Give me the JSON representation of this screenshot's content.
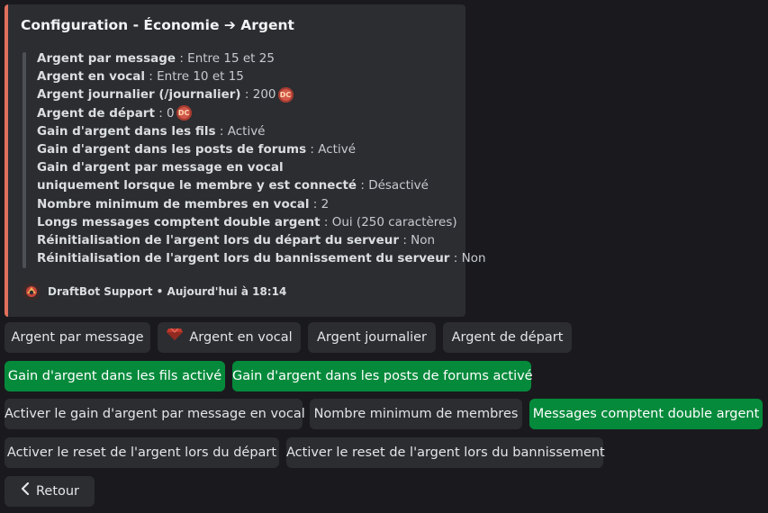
{
  "embed": {
    "title": "Configuration - Économie ➔ Argent",
    "lines": [
      {
        "key": "Argent par message",
        "value": " : Entre 15 et 25"
      },
      {
        "key": "Argent en vocal",
        "value": " : Entre 10 et 15"
      },
      {
        "key": "Argent journalier (/journalier)",
        "value": " : 200",
        "coin": "DC"
      },
      {
        "key": "Argent de départ",
        "value": " : 0",
        "coin": "DC"
      },
      {
        "key": "Gain d'argent dans les fils",
        "value": " : Activé"
      },
      {
        "key": "Gain d'argent dans les posts de forums",
        "value": " : Activé"
      },
      {
        "key": "Gain d'argent par message en vocal",
        "value": ""
      },
      {
        "key": "uniquement lorsque le membre y est connecté",
        "value": " : Désactivé"
      },
      {
        "key": "Nombre minimum de membres en vocal",
        "value": " : 2"
      },
      {
        "key": "Longs messages comptent double argent",
        "value": " : Oui (250 caractères)"
      },
      {
        "key": "Réinitialisation de l'argent lors du départ du serveur",
        "value": " : Non"
      },
      {
        "key": "Réinitialisation de l'argent lors du bannissement du serveur",
        "value": " : Non"
      }
    ],
    "footer": "DraftBot Support • Aujourd'hui à 18:14"
  },
  "buttons": {
    "argent_par_message": "Argent par message",
    "argent_en_vocal": "Argent en vocal",
    "argent_journalier": "Argent journalier",
    "argent_de_depart": "Argent de départ",
    "gain_fils": "Gain d'argent dans les fils activé",
    "gain_forums": "Gain d'argent dans les posts de forums activé",
    "activer_gain_vocal": "Activer le gain d'argent par message en vocal",
    "nombre_minimum": "Nombre minimum de membres",
    "messages_double": "Messages comptent double argent",
    "reset_depart": "Activer le reset de l'argent lors du départ",
    "reset_bannissement": "Activer le reset de l'argent lors du bannissement",
    "retour": "Retour"
  },
  "colors": {
    "background": "#1a1a1e",
    "embed_bg": "#2b2d31",
    "embed_accent": "#e0705c",
    "button_grey": "#2b2d31",
    "button_green": "#058a3b"
  },
  "icons": {
    "coin": "dc-coin-icon",
    "gem": "gem-icon",
    "back": "chevron-left-icon",
    "avatar": "bot-avatar-icon"
  }
}
